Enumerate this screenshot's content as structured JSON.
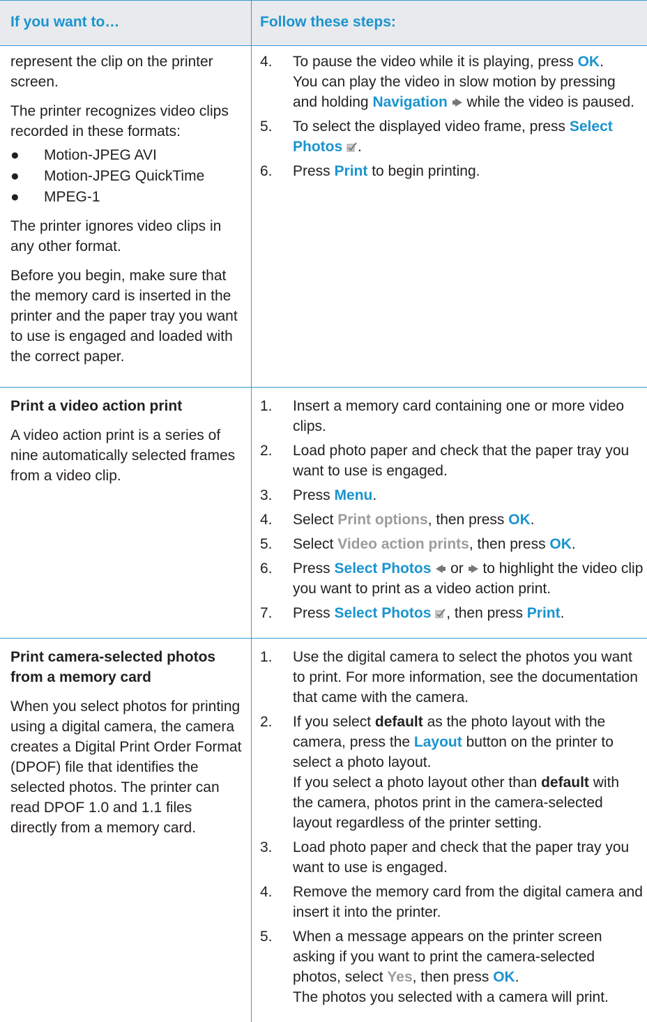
{
  "header": {
    "col1": "If you want to…",
    "col2": "Follow these steps:"
  },
  "row1": {
    "left": {
      "p1": "represent the clip on the printer screen.",
      "p2": "The printer recognizes video clips recorded in these formats:",
      "bullets": [
        "Motion-JPEG AVI",
        "Motion-JPEG QuickTime",
        "MPEG-1"
      ],
      "p3": "The printer ignores video clips in any other format.",
      "p4": "Before you begin, make sure that the memory card is inserted in the printer and the paper tray you want to use is engaged and loaded with the correct paper."
    },
    "steps": {
      "s4_num": "4.",
      "s4_a": "To pause the video while it is playing, press ",
      "s4_b": "OK",
      "s4_c": ".",
      "s4_sub_a": "You can play the video in slow motion by pressing and holding ",
      "s4_sub_b": "Navigation",
      "s4_sub_c": " while the video is paused.",
      "s5_num": "5.",
      "s5_a": "To select the displayed video frame, press ",
      "s5_b": "Select Photos",
      "s5_c": ".",
      "s6_num": "6.",
      "s6_a": "Press ",
      "s6_b": "Print",
      "s6_c": " to begin printing."
    }
  },
  "row2": {
    "left": {
      "title": "Print a video action print",
      "p1": "A video action print is a series of nine automatically selected frames from a video clip."
    },
    "steps": {
      "s1_num": "1.",
      "s1": "Insert a memory card containing one or more video clips.",
      "s2_num": "2.",
      "s2": "Load photo paper and check that the paper tray you want to use is engaged.",
      "s3_num": "3.",
      "s3_a": "Press ",
      "s3_b": "Menu",
      "s3_c": ".",
      "s4_num": "4.",
      "s4_a": "Select ",
      "s4_b": "Print options",
      "s4_c": ", then press ",
      "s4_d": "OK",
      "s4_e": ".",
      "s5_num": "5.",
      "s5_a": "Select ",
      "s5_b": "Video action prints",
      "s5_c": ", then press ",
      "s5_d": "OK",
      "s5_e": ".",
      "s6_num": "6.",
      "s6_a": "Press ",
      "s6_b": "Select Photos",
      "s6_c": " or ",
      "s6_d": " to highlight the video clip you want to print as a video action print.",
      "s7_num": "7.",
      "s7_a": "Press ",
      "s7_b": "Select Photos",
      "s7_c": ", then press ",
      "s7_d": "Print",
      "s7_e": "."
    }
  },
  "row3": {
    "left": {
      "title": "Print camera-selected photos from a memory card",
      "p1": "When you select photos for printing using a digital camera, the camera creates a Digital Print Order Format (DPOF) file that identifies the selected photos. The printer can read DPOF 1.0 and 1.1 files directly from a memory card."
    },
    "steps": {
      "s1_num": "1.",
      "s1": "Use the digital camera to select the photos you want to print. For more information, see the documentation that came with the camera.",
      "s2_num": "2.",
      "s2_a": "If you select ",
      "s2_b": "default",
      "s2_c": " as the photo layout with the camera, press the ",
      "s2_d": "Layout",
      "s2_e": " button on the printer to select a photo layout.",
      "s2_sub_a": "If you select a photo layout other than ",
      "s2_sub_b": "default",
      "s2_sub_c": " with the camera, photos print in the camera-selected layout regardless of the printer setting.",
      "s3_num": "3.",
      "s3": "Load photo paper and check that the paper tray you want to use is engaged.",
      "s4_num": "4.",
      "s4": "Remove the memory card from the digital camera and insert it into the printer.",
      "s5_num": "5.",
      "s5_a": "When a message appears on the printer screen asking if you want to print the camera-selected photos, select ",
      "s5_b": "Yes",
      "s5_c": ", then press ",
      "s5_d": "OK",
      "s5_e": ".",
      "s5_sub": "The photos you selected with a camera will print."
    }
  },
  "colors": {
    "accent": "#1a94cf",
    "menu_gray": "#9a9c9e",
    "rule": "#3a9ad3",
    "header_bg": "#e8eaed"
  }
}
